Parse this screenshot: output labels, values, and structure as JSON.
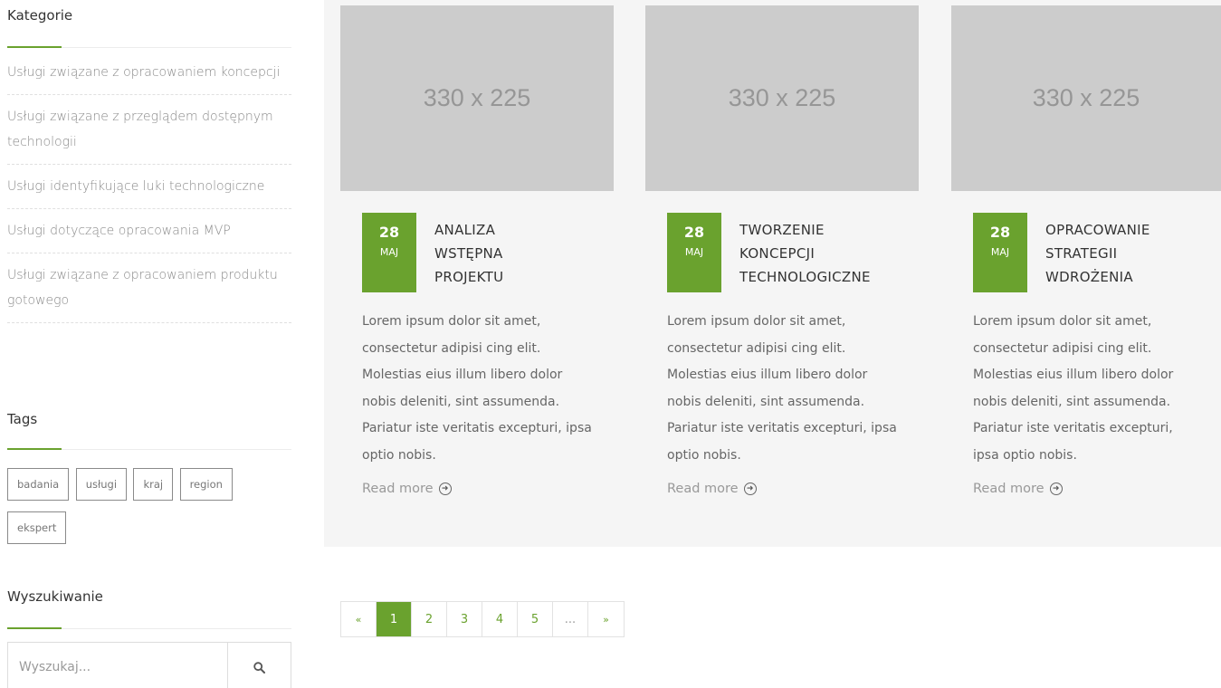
{
  "sidebar": {
    "categories": {
      "title": "Kategorie",
      "items": [
        {
          "label": "Usługi związane z opracowaniem koncepcji"
        },
        {
          "label": "Usługi związane z przeglądem dostępnym technologii"
        },
        {
          "label": "Usługi identyfikujące luki technologiczne"
        },
        {
          "label": "Usługi dotyczące opracowania MVP"
        },
        {
          "label": "Usługi związane z opracowaniem produktu gotowego"
        }
      ]
    },
    "tags": {
      "title": "Tags",
      "items": [
        "badania",
        "usługi",
        "kraj",
        "region",
        "ekspert"
      ]
    },
    "search": {
      "title": "Wyszukiwanie",
      "placeholder": "Wyszukaj..."
    }
  },
  "posts": [
    {
      "thumb_label": "330 x 225",
      "day": "28",
      "month": "MAJ",
      "title_lines": [
        "ANALIZA",
        "WSTĘPNA",
        "PROJEKTU"
      ],
      "excerpt": "Lorem ipsum dolor sit amet, consectetur adipisi cing elit. Molestias eius illum libero dolor nobis deleniti, sint assumenda. Pariatur iste veritatis excepturi, ipsa optio nobis.",
      "read_more": "Read more"
    },
    {
      "thumb_label": "330 x 225",
      "day": "28",
      "month": "MAJ",
      "title_lines": [
        "TWORZENIE",
        "KONCEPCJI",
        "TECHNOLOGICZNE"
      ],
      "excerpt": "Lorem ipsum dolor sit amet, consectetur adipisi cing elit. Molestias eius illum libero dolor nobis deleniti, sint assumenda. Pariatur iste veritatis excepturi, ipsa optio nobis.",
      "read_more": "Read more"
    },
    {
      "thumb_label": "330 x 225",
      "day": "28",
      "month": "MAJ",
      "title_lines": [
        "OPRACOWANIE",
        "STRATEGII",
        "WDROŻENIA"
      ],
      "excerpt": "Lorem ipsum dolor sit amet, consectetur adipisi cing elit. Molestias eius illum libero dolor nobis deleniti, sint assumenda. Pariatur iste veritatis excepturi, ipsa optio nobis.",
      "read_more": "Read more"
    }
  ],
  "pagination": {
    "prev": "«",
    "pages": [
      "1",
      "2",
      "3",
      "4",
      "5",
      "..."
    ],
    "next": "»",
    "active": "1"
  },
  "colors": {
    "accent": "#6aa22e",
    "thumb_bg": "#cccccc",
    "main_bg": "#f5f5f5"
  },
  "icons": {
    "search": "search-icon",
    "read_more": "circle-arrow-right-icon"
  }
}
